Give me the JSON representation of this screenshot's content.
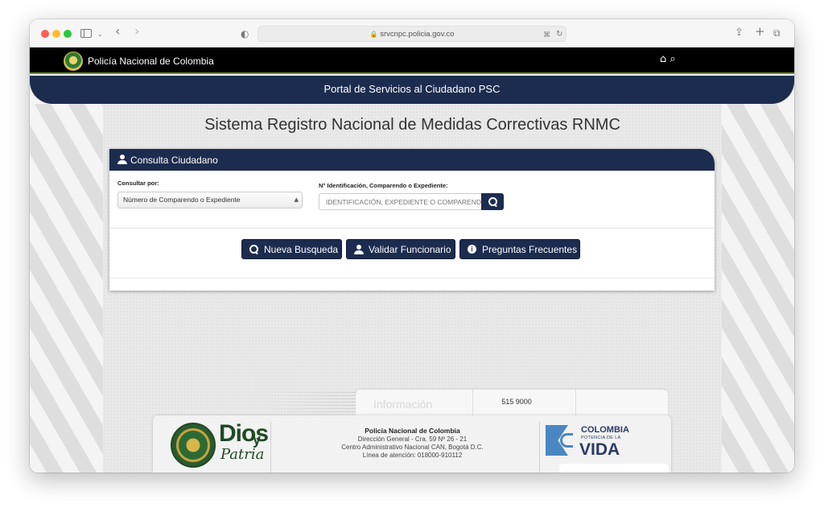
{
  "browser": {
    "url": "srvcnpc.policia.gov.co"
  },
  "header": {
    "org_name": "Policía Nacional de Colombia",
    "home_icon": "home-icon",
    "search_icon": "search-icon"
  },
  "portal": {
    "title": "Portal de Servicios al Ciudadano PSC"
  },
  "page": {
    "title": "Sistema Registro Nacional de Medidas Correctivas RNMC"
  },
  "consulta": {
    "heading": "Consulta Ciudadano",
    "consultar_por_label": "Consultar por:",
    "consultar_por_value": "Número de Comparendo o Expediente",
    "id_label": "N° Identificación, Comparendo o Expediente:",
    "id_placeholder": "IDENTIFICACIÓN, EXPEDIENTE O COMPARENDO",
    "buttons": {
      "nueva": "Nueva Busqueda",
      "validar": "Validar Funcionario",
      "preguntas": "Preguntas Frecuentes"
    }
  },
  "info": {
    "label": "Información",
    "phone": "515 9000"
  },
  "footer": {
    "dios": "Dios",
    "y": "y",
    "patria": "Patria",
    "org": "Policía Nacional de Colombia",
    "line1": "Dirección General - Cra. 59 Nº 26 - 21",
    "line2": "Centro Administrativo Nacional CAN, Bogotá D.C.",
    "line3": "Línea de atención: 018000-910112",
    "brand_word": "COLOMBIA",
    "brand_sub": "POTENCIA DE LA",
    "brand_vida": "VIDA"
  },
  "colors": {
    "navy": "#1c2c4f",
    "green_line": "#6d8b2e"
  }
}
